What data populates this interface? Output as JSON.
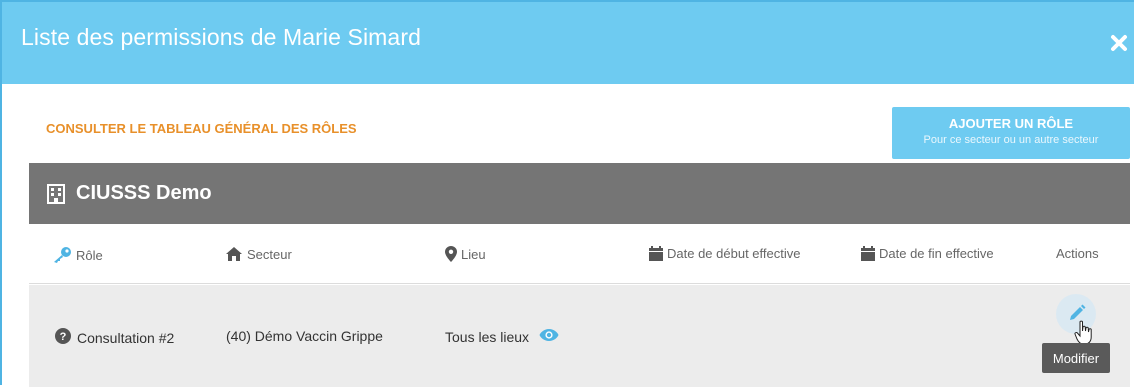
{
  "dialog": {
    "title": "Liste des permissions de Marie Simard",
    "close_icon": "close-icon"
  },
  "actions": {
    "general_link": "CONSULTER LE TABLEAU GÉNÉRAL DES RÔLES",
    "add_role_title": "AJOUTER UN RÔLE",
    "add_role_subtitle": "Pour ce secteur ou un autre secteur"
  },
  "organization": {
    "name": "CIUSSS Demo",
    "icon": "building-icon"
  },
  "table": {
    "headers": [
      {
        "label": "Rôle",
        "icon": "key-icon"
      },
      {
        "label": "Secteur",
        "icon": "home-icon"
      },
      {
        "label": "Lieu",
        "icon": "map-marker-icon"
      },
      {
        "label": "Date de début effective",
        "icon": "calendar-icon"
      },
      {
        "label": "Date de fin effective",
        "icon": "calendar-icon"
      },
      {
        "label": "Actions",
        "icon": ""
      }
    ],
    "rows": [
      {
        "role": "Consultation #2",
        "sector": "(40) Démo Vaccin Grippe",
        "place": "Tous les lieux",
        "start_date": "",
        "end_date": ""
      }
    ]
  },
  "tooltip": "Modifier",
  "colors": {
    "header_bg": "#6ecbf1",
    "org_header_bg": "#757575",
    "link_orange": "#e8902a",
    "icon_blue": "#4fb4e3",
    "row_bg": "#ececec"
  }
}
